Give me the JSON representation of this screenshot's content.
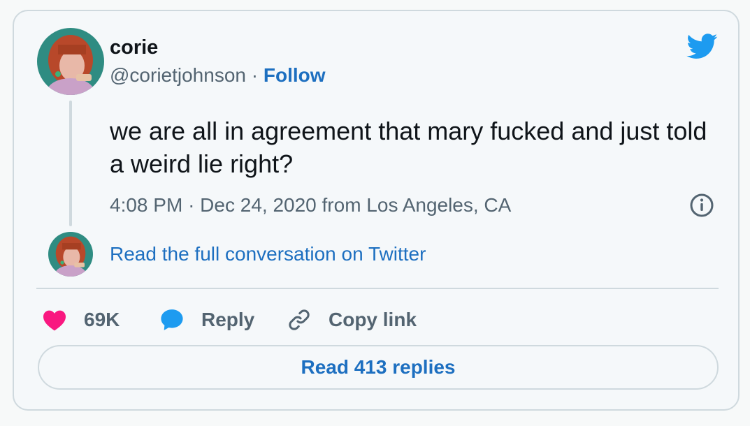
{
  "author": {
    "name": "corie",
    "handle": "@corietjohnson",
    "separator": "·",
    "follow_label": "Follow"
  },
  "tweet": {
    "text": "we are all in agreement that mary fucked and just told a weird lie right?",
    "time": "4:08 PM",
    "meta_separator": "·",
    "date": "Dec 24, 2020",
    "location": "from Los Angeles, CA"
  },
  "conversation_link": "Read the full conversation on Twitter",
  "actions": {
    "likes_label": "69K",
    "reply_label": "Reply",
    "copy_link_label": "Copy link"
  },
  "read_replies_label": "Read 413 replies",
  "icons": {
    "brand": "twitter-bird-icon",
    "info": "info-icon",
    "like": "heart-icon",
    "reply": "speech-bubble-icon",
    "copy": "link-icon"
  },
  "colors": {
    "twitter_blue": "#1d9bf0",
    "link_blue": "#1d6fc0",
    "like_pink": "#f91880",
    "text_primary": "#0f1419",
    "text_secondary": "#536471",
    "border": "#cfd9de"
  }
}
